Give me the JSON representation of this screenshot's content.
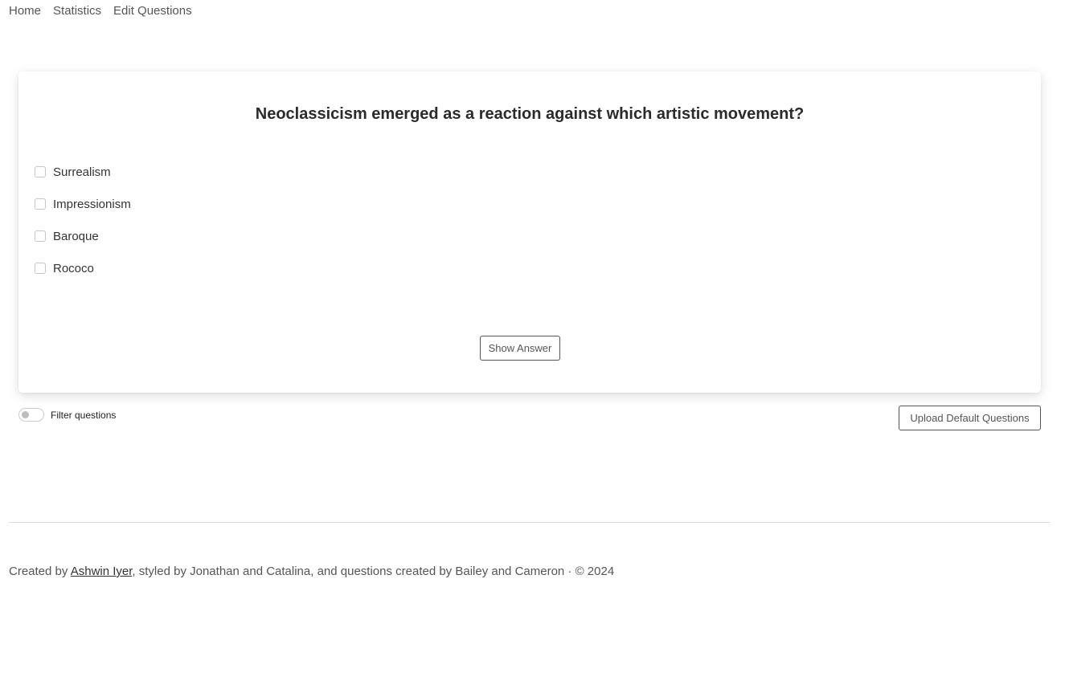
{
  "nav": {
    "items": [
      {
        "label": "Home"
      },
      {
        "label": "Statistics"
      },
      {
        "label": "Edit Questions"
      }
    ]
  },
  "quiz": {
    "question": "Neoclassicism emerged as a reaction against which artistic movement?",
    "options": [
      {
        "label": "Surrealism",
        "checked": false
      },
      {
        "label": "Impressionism",
        "checked": false
      },
      {
        "label": "Baroque",
        "checked": false
      },
      {
        "label": "Rococo",
        "checked": false
      }
    ],
    "show_answer_label": "Show Answer"
  },
  "controls": {
    "filter_label": "Filter questions",
    "filter_enabled": false,
    "upload_label": "Upload Default Questions"
  },
  "footer": {
    "prefix": "Created by ",
    "author_link": "Ashwin Iyer",
    "suffix": ", styled by Jonathan and Catalina, and questions created by Bailey and Cameron · © 2024"
  }
}
